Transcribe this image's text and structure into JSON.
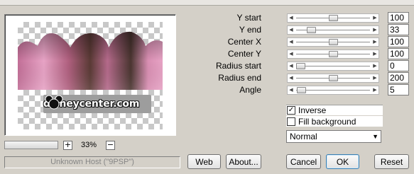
{
  "preview": {
    "watermark_text": "disneycenter.com"
  },
  "zoom": {
    "minus_label": "−",
    "plus_label": "+",
    "value": "33%",
    "slider_level": 0.0
  },
  "status": {
    "text": "Unknown Host (\"9PSP\")"
  },
  "params": [
    {
      "label": "Y start",
      "value": "100",
      "slider_level": 0.5
    },
    {
      "label": "Y end",
      "value": "33",
      "slider_level": 0.17
    },
    {
      "label": "Center X",
      "value": "100",
      "slider_level": 0.5
    },
    {
      "label": "Center Y",
      "value": "100",
      "slider_level": 0.5
    },
    {
      "label": "Radius start",
      "value": "0",
      "slider_level": 0.0
    },
    {
      "label": "Radius end",
      "value": "200",
      "slider_level": 0.5
    },
    {
      "label": "Angle",
      "value": "5",
      "slider_level": 0.01
    }
  ],
  "options": {
    "inverse": {
      "label": "Inverse",
      "checked": true,
      "mark": "✓"
    },
    "fill_background": {
      "label": "Fill background",
      "checked": false
    }
  },
  "blend_mode": {
    "selected": "Normal"
  },
  "buttons": {
    "web": "Web",
    "about": "About...",
    "cancel": "Cancel",
    "ok": "OK",
    "reset": "Reset"
  },
  "colors": {
    "gradient_dark": "#4a3530",
    "gradient_light": "#e7a3c5",
    "pink_fill": "#d88fb4"
  }
}
